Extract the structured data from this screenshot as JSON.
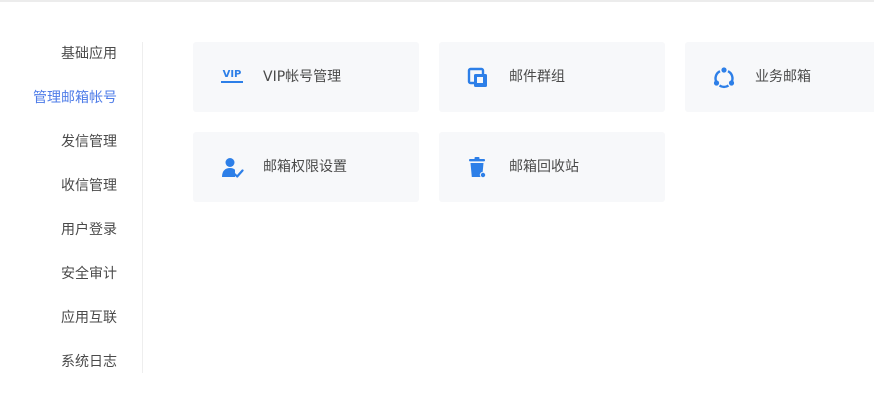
{
  "accent_color": "#4e7ce8",
  "icon_color": "#2d7fe8",
  "sidebar": {
    "items": [
      {
        "label": "基础应用",
        "active": false
      },
      {
        "label": "管理邮箱帐号",
        "active": true
      },
      {
        "label": "发信管理",
        "active": false
      },
      {
        "label": "收信管理",
        "active": false
      },
      {
        "label": "用户登录",
        "active": false
      },
      {
        "label": "安全审计",
        "active": false
      },
      {
        "label": "应用互联",
        "active": false
      },
      {
        "label": "系统日志",
        "active": false
      }
    ]
  },
  "cards": [
    {
      "label": "VIP帐号管理",
      "icon": "vip-icon",
      "icon_text": "VIP"
    },
    {
      "label": "邮件群组",
      "icon": "group-icon"
    },
    {
      "label": "业务邮箱",
      "icon": "business-mailbox-icon"
    },
    {
      "label": "邮箱权限设置",
      "icon": "user-permission-icon"
    },
    {
      "label": "邮箱回收站",
      "icon": "trash-icon"
    }
  ]
}
